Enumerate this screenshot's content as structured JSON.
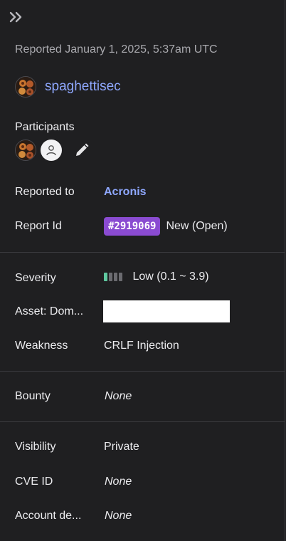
{
  "reported": "Reported January 1, 2025, 5:37am UTC",
  "reporter": {
    "name": "spaghettisec"
  },
  "participants": {
    "label": "Participants"
  },
  "reported_to": {
    "label": "Reported to",
    "value": "Acronis"
  },
  "report_id": {
    "label": "Report Id",
    "id": "#2919069",
    "status": "New (Open)"
  },
  "severity": {
    "label": "Severity",
    "value": "Low (0.1 ~ 3.9)",
    "level_segments_filled": 1,
    "level_segments_total": 4,
    "colors": {
      "filled": "#5fc9a0",
      "empty": "#6b6b70"
    }
  },
  "asset": {
    "label": "Asset: Dom...",
    "value": ""
  },
  "weakness": {
    "label": "Weakness",
    "value": "CRLF Injection"
  },
  "bounty": {
    "label": "Bounty",
    "value": "None"
  },
  "visibility": {
    "label": "Visibility",
    "value": "Private"
  },
  "cve": {
    "label": "CVE ID",
    "value": "None"
  },
  "account": {
    "label": "Account de...",
    "value": "None"
  },
  "colors": {
    "accent": "#8fa8ff",
    "badge": "#8a4bd1",
    "background": "#1f1f21"
  }
}
